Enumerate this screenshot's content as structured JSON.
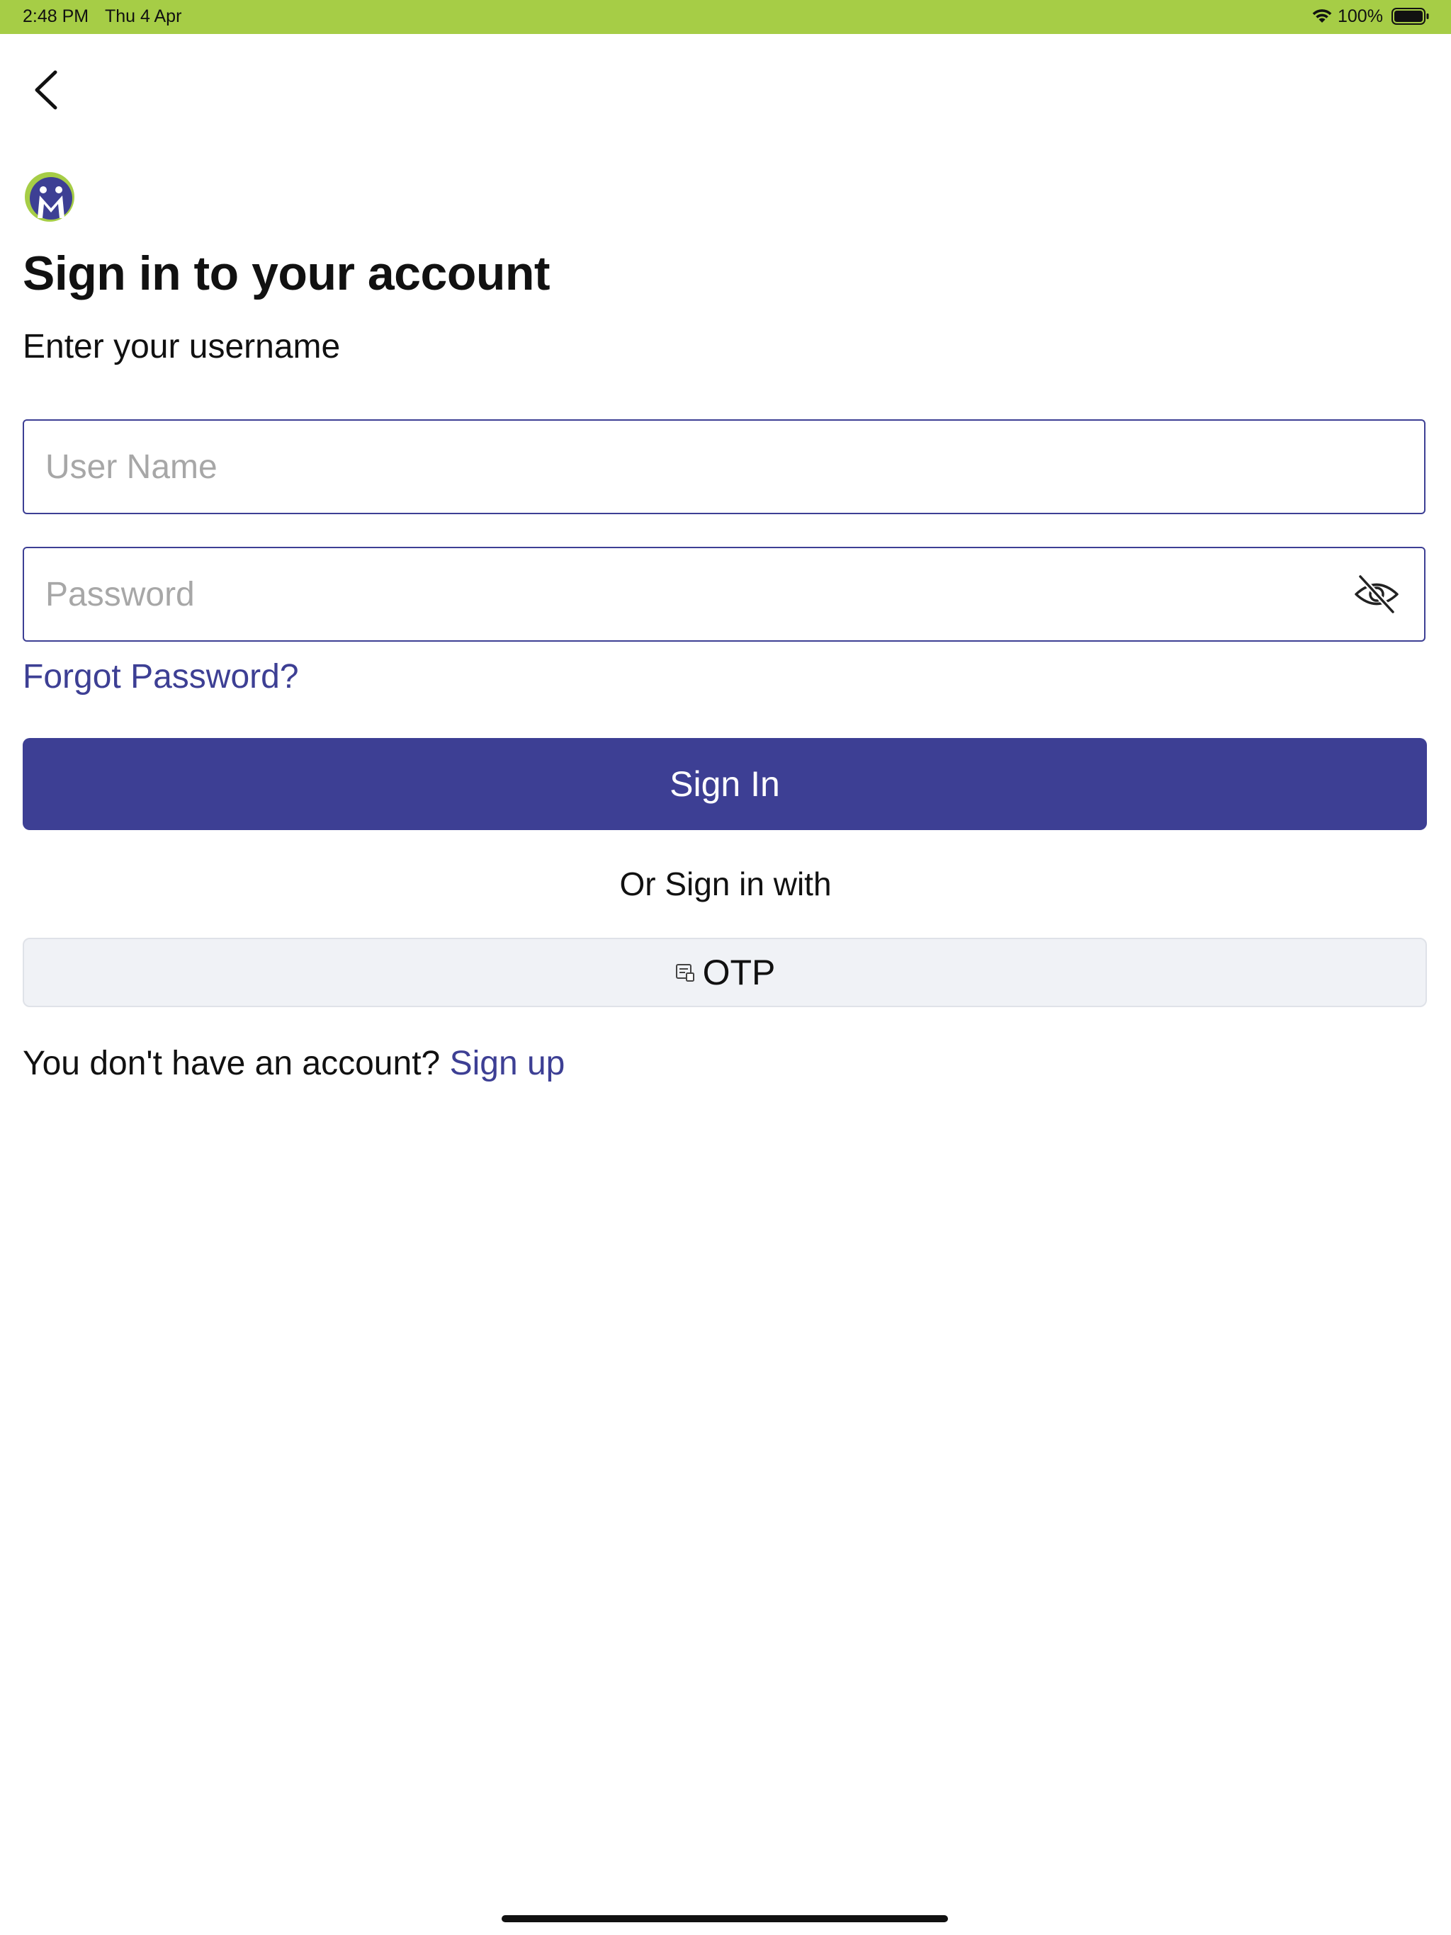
{
  "status_bar": {
    "time": "2:48 PM",
    "date": "Thu 4 Apr",
    "battery": "100%",
    "color": "#a6cd46"
  },
  "header": {
    "back_icon": "chevron-left-icon",
    "logo_icon": "app-logo"
  },
  "main": {
    "title": "Sign in to your account",
    "subtitle": "Enter your username",
    "username_placeholder": "User Name",
    "username_value": "",
    "password_placeholder": "Password",
    "password_value": "",
    "password_toggle_icon": "eye-slash-icon",
    "forgot_label": "Forgot Password?",
    "signin_label": "Sign In",
    "or_label": "Or Sign in with",
    "otp_icon": "message-icon",
    "otp_label": "OTP",
    "no_account_text": "You don't have an account?",
    "signup_label": "Sign up"
  },
  "colors": {
    "primary": "#3d3f94",
    "status_bar": "#a6cd46",
    "otp_bg": "#f0f2f6"
  }
}
